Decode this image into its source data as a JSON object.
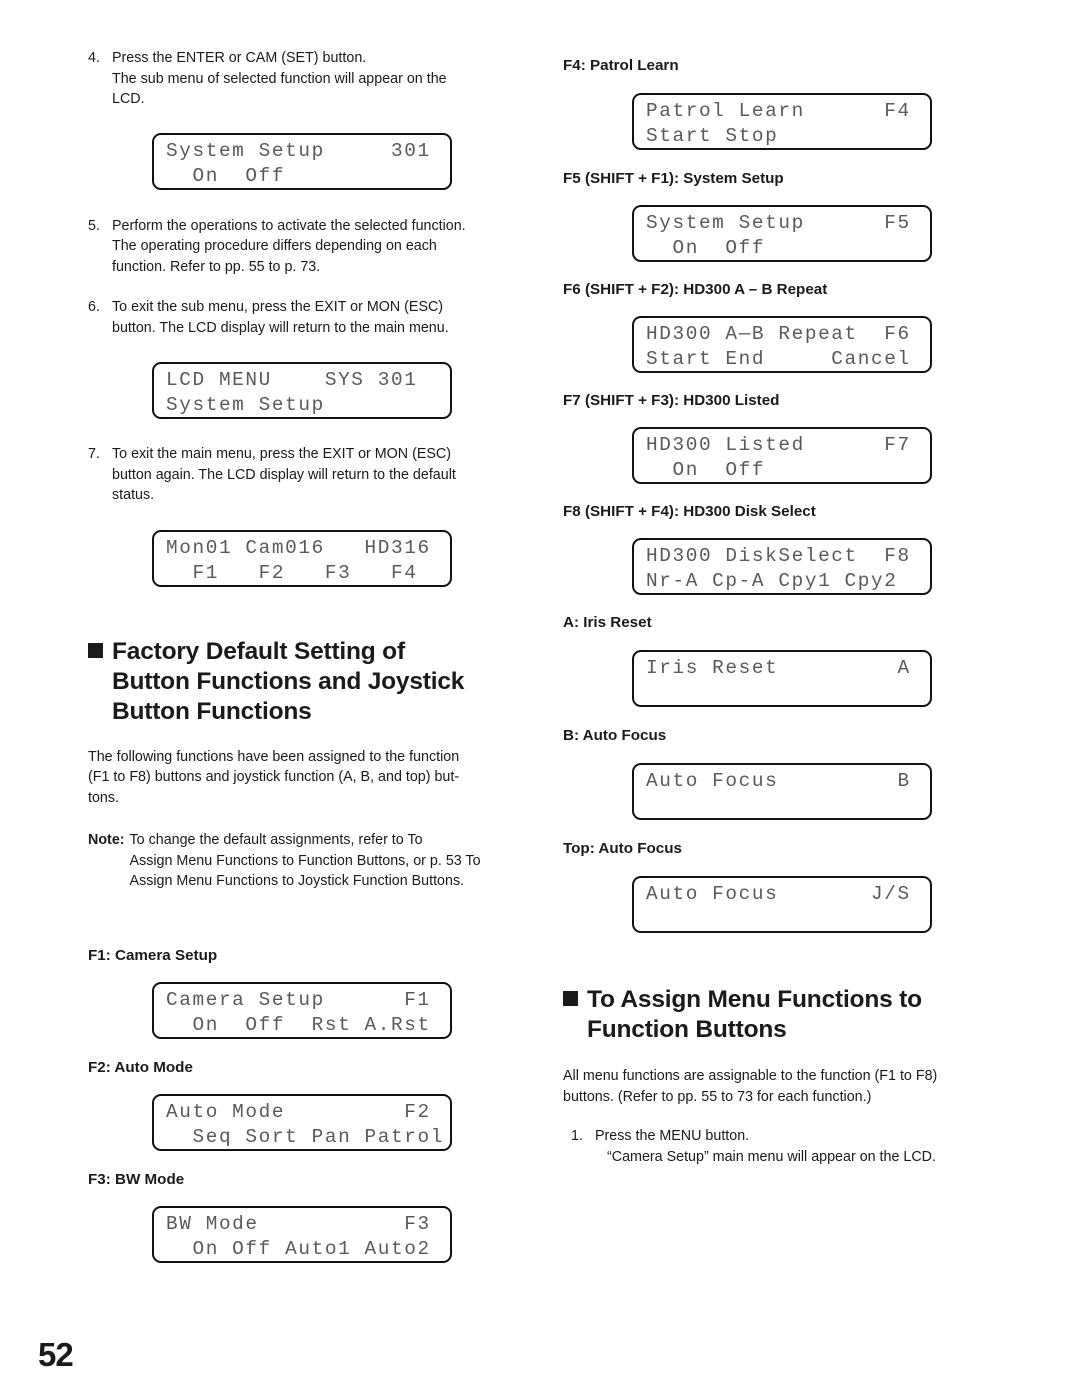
{
  "page_number": "52",
  "left_column": {
    "step4": {
      "num": "4.",
      "line1": "Press the ENTER or CAM (SET) button.",
      "line2": "The sub menu of selected function will appear on the",
      "line3": "LCD."
    },
    "lcd_system_setup_301": {
      "line1": "System Setup     301",
      "line2": "  On  Off"
    },
    "step5": {
      "num": "5.",
      "line1": "Perform the operations to activate the selected function.",
      "line2": "The operating procedure differs depending on each",
      "line3": "function. Refer to pp. 55 to p. 73."
    },
    "step6": {
      "num": "6.",
      "line1": "To exit the sub menu, press the EXIT or MON (ESC)",
      "line2": "button. The LCD display will return to the main menu."
    },
    "lcd_main_menu": {
      "line1": "LCD MENU    SYS 301",
      "line2": "System Setup"
    },
    "step7": {
      "num": "7.",
      "line1": "To exit the main menu, press the EXIT or MON (ESC)",
      "line2": "button again. The LCD display will return to the default",
      "line3": "status."
    },
    "lcd_default_status": {
      "line1": "Mon01 Cam016   HD316",
      "line2": "  F1   F2   F3   F4"
    },
    "heading_factory_default": {
      "line1": "Factory Default Setting of",
      "line2": "Button Functions and Joystick",
      "line3": "Button Functions"
    },
    "intro_paragraph": {
      "line1": "The following functions have been assigned to the function",
      "line2": "(F1 to F8) buttons and joystick function (A, B, and top) but-",
      "line3": "tons."
    },
    "note": {
      "label": "Note:",
      "line1": "To change the default assignments, refer to To",
      "line2": "Assign Menu Functions to Function Buttons, or p. 53 To",
      "line3": "Assign Menu Functions to Joystick Function Buttons."
    },
    "f1": {
      "heading": "F1: Camera Setup",
      "lcd_line1": "Camera Setup      F1",
      "lcd_line2": "  On  Off  Rst A.Rst"
    },
    "f2": {
      "heading": "F2: Auto Mode",
      "lcd_line1": "Auto Mode         F2",
      "lcd_line2": "  Seq Sort Pan Patrol"
    },
    "f3": {
      "heading": "F3: BW Mode",
      "lcd_line1": "BW Mode           F3",
      "lcd_line2": "  On Off Auto1 Auto2"
    }
  },
  "right_column": {
    "f4": {
      "heading": "F4: Patrol Learn",
      "lcd_line1": "Patrol Learn      F4",
      "lcd_line2": "Start Stop"
    },
    "f5": {
      "heading": "F5 (SHIFT + F1): System Setup",
      "lcd_line1": "System Setup      F5",
      "lcd_line2": "  On  Off"
    },
    "f6": {
      "heading": "F6 (SHIFT + F2): HD300 A – B Repeat",
      "lcd_line1": "HD300 A—B Repeat  F6",
      "lcd_line2": "Start End     Cancel"
    },
    "f7": {
      "heading": "F7 (SHIFT + F3): HD300 Listed",
      "lcd_line1": "HD300 Listed      F7",
      "lcd_line2": "  On  Off"
    },
    "f8": {
      "heading": "F8 (SHIFT + F4): HD300 Disk Select",
      "lcd_line1": "HD300 DiskSelect  F8",
      "lcd_line2": "Nr-A Cp-A Cpy1 Cpy2"
    },
    "joy_a": {
      "heading": "A: Iris Reset",
      "lcd_line1": "Iris Reset         A",
      "lcd_line2": ""
    },
    "joy_b": {
      "heading": "B: Auto Focus",
      "lcd_line1": "Auto Focus         B",
      "lcd_line2": ""
    },
    "joy_top": {
      "heading": "Top: Auto Focus",
      "lcd_line1": "Auto Focus       J/S",
      "lcd_line2": ""
    },
    "heading_assign": {
      "line1": "To Assign Menu Functions to",
      "line2": "Function Buttons"
    },
    "assign_paragraph": {
      "line1": "All menu functions are assignable to the function (F1 to F8)",
      "line2": "buttons. (Refer to pp. 55 to 73 for each function.)"
    },
    "assign_step1": {
      "num": "1.",
      "line1": "Press the MENU button.",
      "line2": "“Camera Setup” main menu will appear on the LCD."
    }
  }
}
